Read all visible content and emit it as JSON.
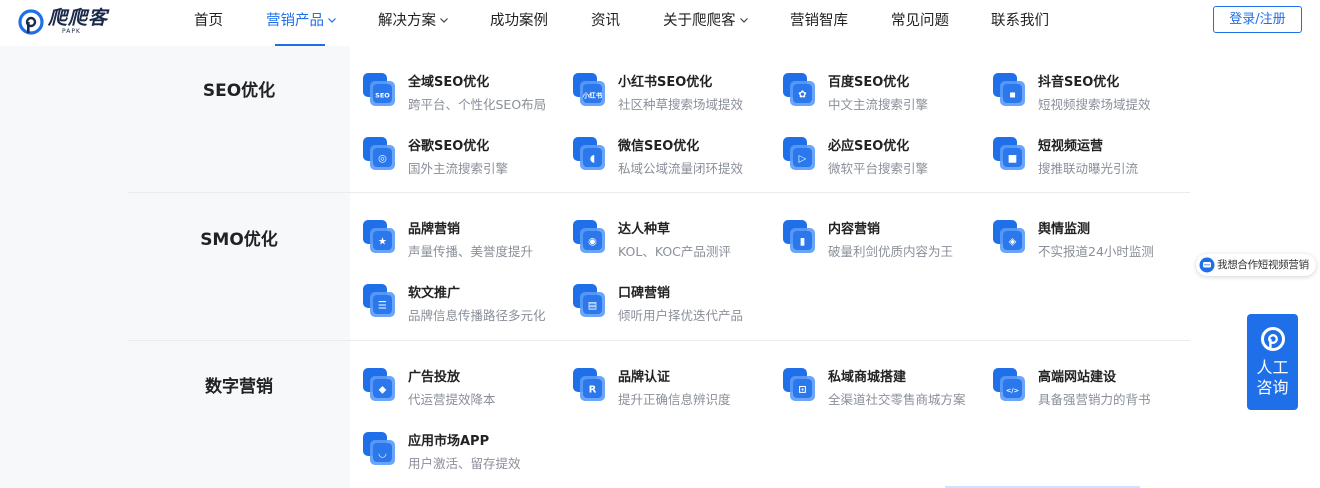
{
  "header": {
    "logo_text": "爬爬客",
    "logo_sub": "PAPK",
    "nav": [
      {
        "label": "首页",
        "has_caret": false,
        "active": false
      },
      {
        "label": "营销产品",
        "has_caret": true,
        "active": true
      },
      {
        "label": "解决方案",
        "has_caret": true,
        "active": false
      },
      {
        "label": "成功案例",
        "has_caret": false,
        "active": false
      },
      {
        "label": "资讯",
        "has_caret": false,
        "active": false
      },
      {
        "label": "关于爬爬客",
        "has_caret": true,
        "active": false
      },
      {
        "label": "营销智库",
        "has_caret": false,
        "active": false
      },
      {
        "label": "常见问题",
        "has_caret": false,
        "active": false
      },
      {
        "label": "联系我们",
        "has_caret": false,
        "active": false
      }
    ],
    "login_label": "登录/注册"
  },
  "categories": [
    {
      "title": "SEO优化",
      "items": [
        {
          "title": "全域SEO优化",
          "desc": "跨平台、个性化SEO布局",
          "icon": "seo-globe-icon",
          "glyph": "SEO"
        },
        {
          "title": "小红书SEO优化",
          "desc": "社区种草搜索场域提效",
          "icon": "xiaohongshu-icon",
          "glyph": "小红书"
        },
        {
          "title": "百度SEO优化",
          "desc": "中文主流搜索引擎",
          "icon": "baidu-paw-icon",
          "glyph": "✿"
        },
        {
          "title": "抖音SEO优化",
          "desc": "短视频搜索场域提效",
          "icon": "douyin-icon",
          "glyph": "▪"
        },
        {
          "title": "谷歌SEO优化",
          "desc": "国外主流搜索引擎",
          "icon": "google-chrome-icon",
          "glyph": "◎"
        },
        {
          "title": "微信SEO优化",
          "desc": "私域公域流量闭环提效",
          "icon": "wechat-icon",
          "glyph": "◖"
        },
        {
          "title": "必应SEO优化",
          "desc": "微软平台搜索引擎",
          "icon": "bing-icon",
          "glyph": "▷"
        },
        {
          "title": "短视频运营",
          "desc": "搜推联动曝光引流",
          "icon": "video-camera-icon",
          "glyph": "■"
        }
      ]
    },
    {
      "title": "SMO优化",
      "items": [
        {
          "title": "品牌营销",
          "desc": "声量传播、美誉度提升",
          "icon": "brand-star-icon",
          "glyph": "★"
        },
        {
          "title": "达人种草",
          "desc": "KOL、KOC产品测评",
          "icon": "influencer-icon",
          "glyph": "◉"
        },
        {
          "title": "内容营销",
          "desc": "破量利剑优质内容为王",
          "icon": "content-chart-icon",
          "glyph": "▮"
        },
        {
          "title": "舆情监测",
          "desc": "不实报道24小时监测",
          "icon": "monitor-icon",
          "glyph": "◈"
        },
        {
          "title": "软文推广",
          "desc": "品牌信息传播路径多元化",
          "icon": "article-list-icon",
          "glyph": "☰"
        },
        {
          "title": "口碑营销",
          "desc": "倾听用户择优迭代产品",
          "icon": "reputation-chat-icon",
          "glyph": "▤"
        }
      ]
    },
    {
      "title": "数字营销",
      "items": [
        {
          "title": "广告投放",
          "desc": "代运营提效降本",
          "icon": "ad-cube-icon",
          "glyph": "◆"
        },
        {
          "title": "品牌认证",
          "desc": "提升正确信息辨识度",
          "icon": "brand-cert-icon",
          "glyph": "R"
        },
        {
          "title": "私域商城搭建",
          "desc": "全渠道社交零售商城方案",
          "icon": "shop-cart-icon",
          "glyph": "⊡"
        },
        {
          "title": "高端网站建设",
          "desc": "具备强营销力的背书",
          "icon": "website-code-icon",
          "glyph": "</>"
        },
        {
          "title": "应用市场APP",
          "desc": "用户激活、留存提效",
          "icon": "app-bag-icon",
          "glyph": "◡"
        }
      ]
    }
  ],
  "widgets": {
    "chat_pill_text": "我想合作短视频营销",
    "consult_line1": "人工",
    "consult_line2": "咨询"
  },
  "colors": {
    "accent": "#1f6fe8",
    "left_panel_bg": "#f7f8fa",
    "desc_text": "#8a8f99"
  }
}
